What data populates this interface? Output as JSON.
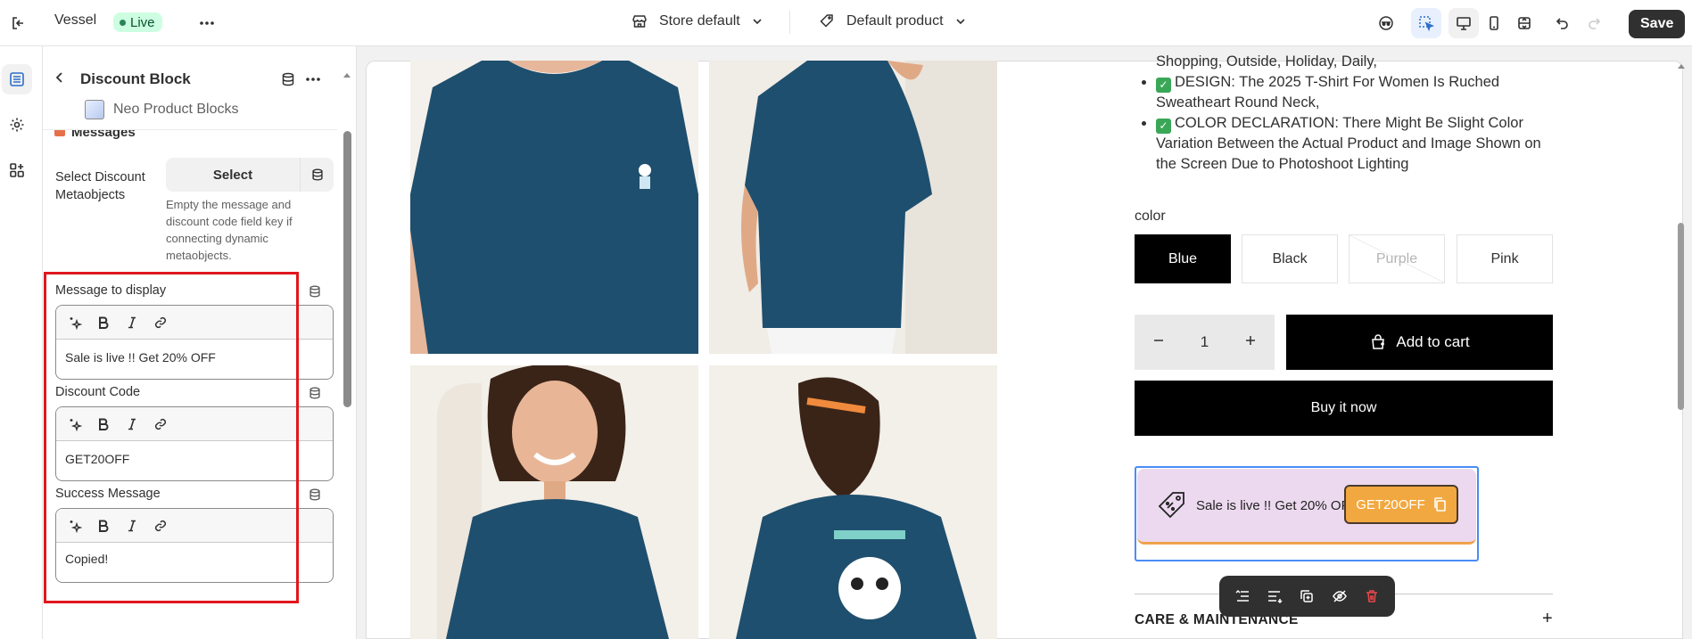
{
  "topbar": {
    "app_name": "Vessel",
    "live_badge": "Live",
    "store_selector": "Store default",
    "product_selector": "Default product",
    "save_label": "Save"
  },
  "panel": {
    "title": "Discount Block",
    "subtitle": "Neo Product Blocks",
    "clipped_section": "Messages",
    "select_metaobjects_label": "Select Discount Metaobjects",
    "select_button": "Select",
    "help_text": "Empty the message and discount code field key if connecting dynamic metaobjects.",
    "fields": [
      {
        "label": "Message to display",
        "value": "Sale is live !! Get 20% OFF"
      },
      {
        "label": "Discount Code",
        "value": "GET20OFF"
      },
      {
        "label": "Success Message",
        "value": "Copied!"
      }
    ]
  },
  "preview": {
    "bullets": [
      "Shopping, Outside, Holiday, Daily,",
      "DESIGN: The 2025 T-Shirt For Women Is Ruched Sweatheart Round Neck,",
      "COLOR DECLARATION: There Might Be Slight Color Variation Between the Actual Product and Image Shown on the Screen Due to Photoshoot Lighting"
    ],
    "color_label": "color",
    "colors": [
      "Blue",
      "Black",
      "Purple",
      "Pink"
    ],
    "selected_color": "Blue",
    "quantity": "1",
    "add_to_cart": "Add to cart",
    "buy_now": "Buy it now",
    "discount_message": "Sale is live !! Get 20% OFF",
    "discount_code": "GET20OFF",
    "care_heading": "CARE & MAINTENANCE"
  },
  "colors": {
    "accent_blue": "#4a8cf6",
    "highlight_red": "#e0171d",
    "discount_bg": "#ecd9ef",
    "code_button": "#f2a840",
    "shirt": "#1f4f6e"
  }
}
